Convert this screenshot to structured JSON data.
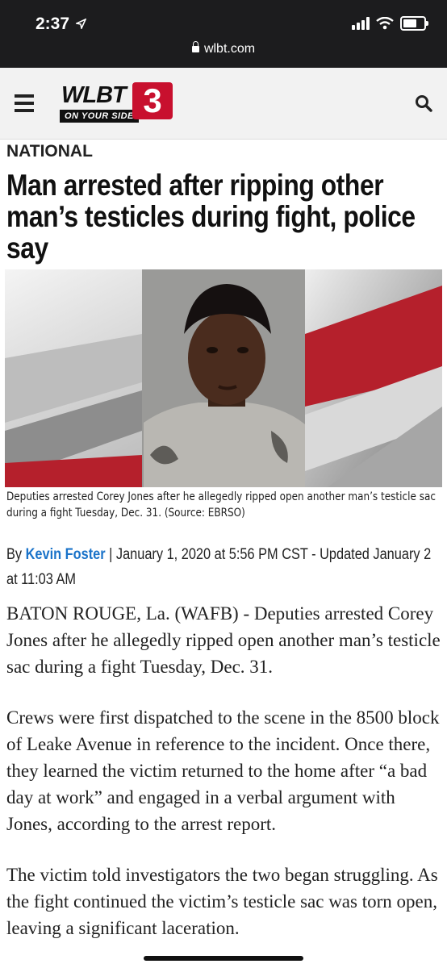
{
  "status_bar": {
    "time": "2:37"
  },
  "browser": {
    "url": "wlbt.com"
  },
  "site": {
    "logo_name": "WLBT",
    "logo_tagline": "ON YOUR SIDE",
    "logo_number": "3"
  },
  "article": {
    "section": "NATIONAL",
    "headline": "Man arrested after ripping other man’s testicles during fight, police say",
    "caption": "Deputies arrested Corey Jones after he allegedly ripped open another man’s testicle sac during a fight Tuesday, Dec. 31. (Source: EBRSO)",
    "byline": {
      "prefix": "By ",
      "author": "Kevin Foster",
      "rest": " | January 1, 2020 at 5:56 PM CST - Updated January 2 at 11:03 AM"
    },
    "paragraphs": [
      "BATON ROUGE, La. (WAFB) - Deputies arrested Corey Jones after he allegedly ripped open another man’s testicle sac during a fight Tuesday, Dec. 31.",
      "Crews were first dispatched to the scene in the 8500 block of Leake Avenue in reference to the incident. Once there, they learned the victim returned to the home after “a bad day at work” and engaged in a verbal argument with Jones, according to the arrest report.",
      "The victim told investigators the two began struggling. As the fight continued the victim’s testicle sac was torn open, leaving a significant laceration."
    ]
  },
  "icons": [
    "location-arrow-icon",
    "signal-icon",
    "wifi-icon",
    "battery-icon",
    "lock-icon",
    "menu-icon",
    "search-icon"
  ],
  "colors": {
    "brand_red": "#c8102e",
    "link_blue": "#1a73c9",
    "topbar": "#1c1c1e"
  }
}
